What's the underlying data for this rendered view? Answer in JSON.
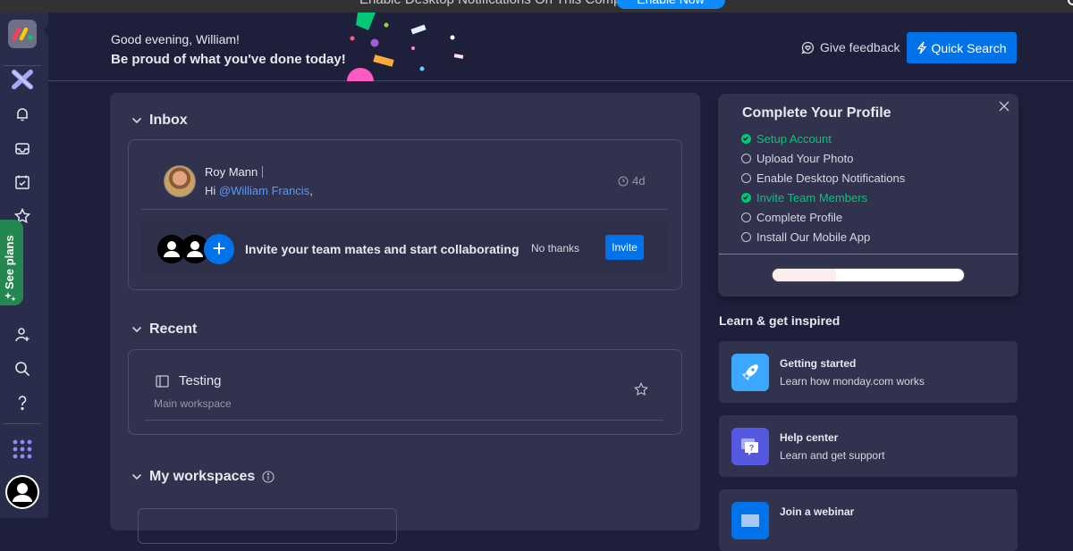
{
  "banner": {
    "message": "Enable Desktop Notifications On This Computer",
    "enable_label": "Enable Now"
  },
  "header": {
    "greeting": "Good evening, William!",
    "subtitle": "Be proud of what you've done today!",
    "feedback_label": "Give feedback",
    "quick_search_label": "Quick Search"
  },
  "sidebar": {
    "see_plans_label": "See plans",
    "items": [
      {
        "icon": "workspace-switch-icon"
      },
      {
        "icon": "bell-icon",
        "label": "Notifications"
      },
      {
        "icon": "inbox-icon",
        "label": "Inbox"
      },
      {
        "icon": "calendar-check-icon",
        "label": "My work"
      },
      {
        "icon": "star-icon",
        "label": "Favorites"
      },
      {
        "icon": "invite-user-icon",
        "label": "Invite members"
      },
      {
        "icon": "search-icon",
        "label": "Search"
      },
      {
        "icon": "help-icon",
        "label": "Help"
      },
      {
        "icon": "apps-grid-icon",
        "label": "Apps"
      }
    ]
  },
  "inbox": {
    "title": "Inbox",
    "message": {
      "sender": "Roy Mann",
      "greeting": "Hi ",
      "mention": "@William Francis",
      "suffix": ",",
      "time": "4d"
    },
    "invite": {
      "text": "Invite your team mates and start collaborating",
      "no_thanks_label": "No thanks",
      "invite_label": "Invite"
    }
  },
  "recent": {
    "title": "Recent",
    "items": [
      {
        "name": "Testing",
        "workspace": "Main workspace"
      }
    ]
  },
  "workspaces": {
    "title": "My workspaces"
  },
  "profile": {
    "title": "Complete Your Profile",
    "progress_fraction": 0.333,
    "items": [
      {
        "label": "Setup Account",
        "done": true
      },
      {
        "label": "Upload Your Photo",
        "done": false
      },
      {
        "label": "Enable Desktop Notifications",
        "done": false
      },
      {
        "label": "Invite Team Members",
        "done": true
      },
      {
        "label": "Complete Profile",
        "done": false
      },
      {
        "label": "Install Our Mobile App",
        "done": false
      }
    ]
  },
  "learn": {
    "title": "Learn & get inspired",
    "cards": [
      {
        "name": "Getting started",
        "desc": "Learn how monday.com works",
        "icon": "rocket-icon",
        "color": "#3ba7ff"
      },
      {
        "name": "Help center",
        "desc": "Learn and get support",
        "icon": "help-center-icon",
        "color": "#5559df"
      },
      {
        "name": "Join a webinar",
        "desc": "",
        "icon": "webinar-icon",
        "color": "#0073ea"
      }
    ]
  },
  "colors": {
    "primary": "#0073ea",
    "success": "#00c875",
    "mention": "#579bfc"
  }
}
